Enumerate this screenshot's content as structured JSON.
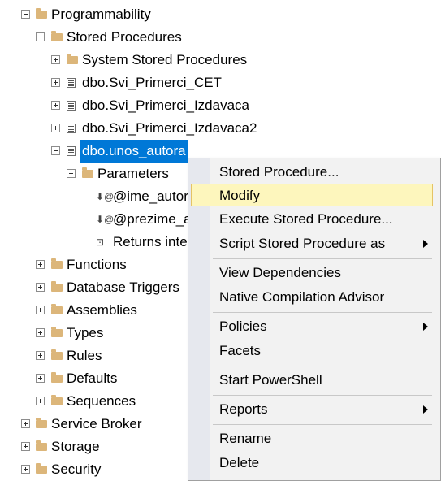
{
  "tree": {
    "programmability": "Programmability",
    "stored_procedures": "Stored Procedures",
    "system_stored_procedures": "System Stored Procedures",
    "proc1": "dbo.Svi_Primerci_CET",
    "proc2": "dbo.Svi_Primerci_Izdavaca",
    "proc3": "dbo.Svi_Primerci_Izdavaca2",
    "proc_selected": "dbo.unos_autora",
    "parameters": "Parameters",
    "param1": "@ime_autor",
    "param2": "@prezime_a",
    "returns": "Returns inte",
    "functions": "Functions",
    "database_triggers": "Database Triggers",
    "assemblies": "Assemblies",
    "types": "Types",
    "rules": "Rules",
    "defaults": "Defaults",
    "sequences": "Sequences",
    "service_broker": "Service Broker",
    "storage": "Storage",
    "security": "Security"
  },
  "context_menu": {
    "stored_procedure": "Stored Procedure...",
    "modify": "Modify",
    "execute": "Execute Stored Procedure...",
    "script_as": "Script Stored Procedure as",
    "view_dependencies": "View Dependencies",
    "native_compilation": "Native Compilation Advisor",
    "policies": "Policies",
    "facets": "Facets",
    "start_powershell": "Start PowerShell",
    "reports": "Reports",
    "rename": "Rename",
    "delete": "Delete"
  },
  "colors": {
    "selection": "#0078d7",
    "hover": "#fdf6bd",
    "folder": "#dcb67a"
  }
}
